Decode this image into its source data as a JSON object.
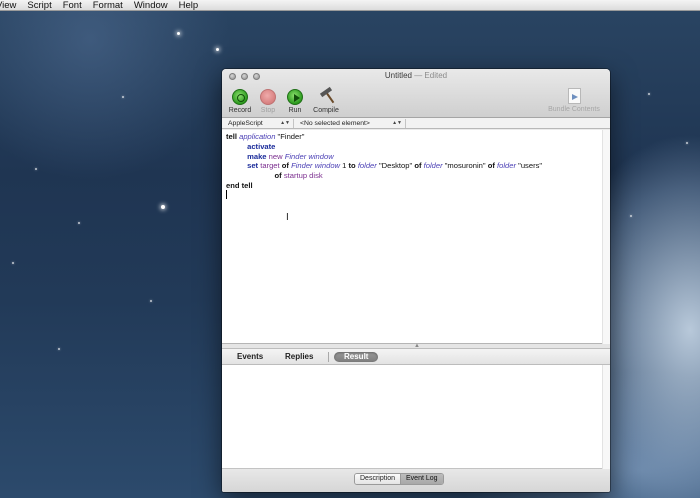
{
  "menubar": {
    "items": [
      "View",
      "Script",
      "Font",
      "Format",
      "Window",
      "Help"
    ]
  },
  "window": {
    "title": "Untitled",
    "edited": " — Edited",
    "toolbar": {
      "record": "Record",
      "stop": "Stop",
      "run": "Run",
      "compile": "Compile",
      "bundle_contents": "Bundle Contents"
    },
    "navbar": {
      "language": "AppleScript",
      "element": "<No selected element>"
    },
    "script": {
      "l1_kw": "tell",
      "l1_cls": "application",
      "l1_str": "\"Finder\"",
      "l2_cmd": "activate",
      "l3_cmd": "make",
      "l3_kw": "new",
      "l3_cls": "Finder window",
      "l4_cmd": "set",
      "l4_prop": "target",
      "l4_of1": "of",
      "l4_cls1": "Finder window",
      "l4_num": "1",
      "l4_to": "to",
      "l4_cls2": "folder",
      "l4_str1": "\"Desktop\"",
      "l4_of2": "of",
      "l4_cls3": "folder",
      "l4_str2": "\"mosuronin\"",
      "l4_of3": "of",
      "l4_cls4": "folder",
      "l4_str3": "\"users\"",
      "l5_of": "of",
      "l5_prop": "startup disk",
      "l6_kw": "end tell"
    },
    "tabs": {
      "events": "Events",
      "replies": "Replies",
      "result": "Result"
    },
    "bottom": {
      "description": "Description",
      "event_log": "Event Log"
    }
  }
}
